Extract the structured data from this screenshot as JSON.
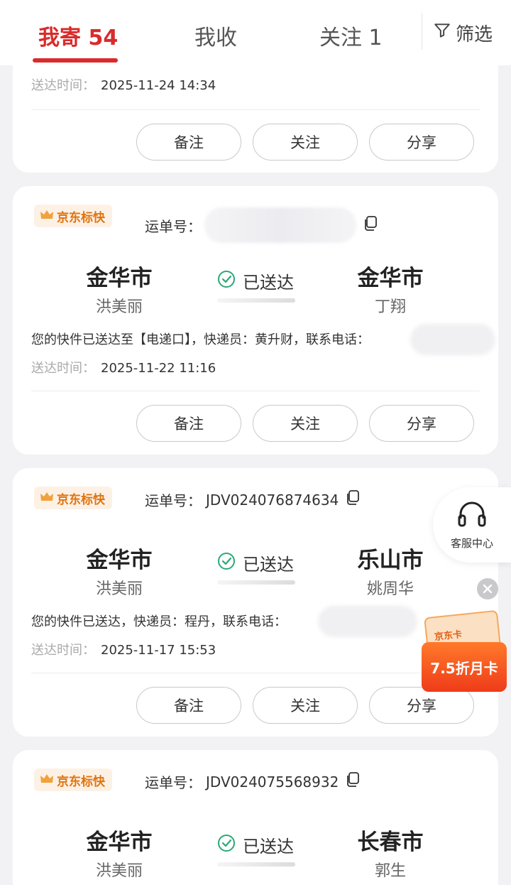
{
  "tabs": {
    "send": "我寄 54",
    "receive": "我收",
    "follow": "关注 1",
    "filter": "筛选"
  },
  "labels": {
    "waybill": "运单号：",
    "time": "送达时间：",
    "status": "已送达",
    "brand": "京东标快"
  },
  "actions": {
    "note": "备注",
    "follow": "关注",
    "share": "分享"
  },
  "card_top": {
    "time": "2025-11-24 14:34"
  },
  "cards": [
    {
      "waybill": "",
      "from_city": "金华市",
      "from_person": "洪美丽",
      "to_city": "金华市",
      "to_person": "丁翔",
      "message": "您的快件已送达至【电递口】，快递员：黄升财，联系电话：",
      "time": "2025-11-22 11:16"
    },
    {
      "waybill": "JDV024076874634",
      "from_city": "金华市",
      "from_person": "洪美丽",
      "to_city": "乐山市",
      "to_person": "姚周华",
      "message": "您的快件已送达，快递员：程丹，联系电话：",
      "time": "2025-11-17 15:53"
    },
    {
      "waybill": "JDV024075568932",
      "from_city": "金华市",
      "from_person": "洪美丽",
      "to_city": "长春市",
      "to_person": "郭生"
    }
  ],
  "service": {
    "label": "客服中心"
  },
  "promo": {
    "card_text": "京东卡",
    "label": "7.5折月卡"
  },
  "colors": {
    "accent": "#d92b2b",
    "brand_orange": "#e0740f",
    "status_green": "#2aa876"
  }
}
